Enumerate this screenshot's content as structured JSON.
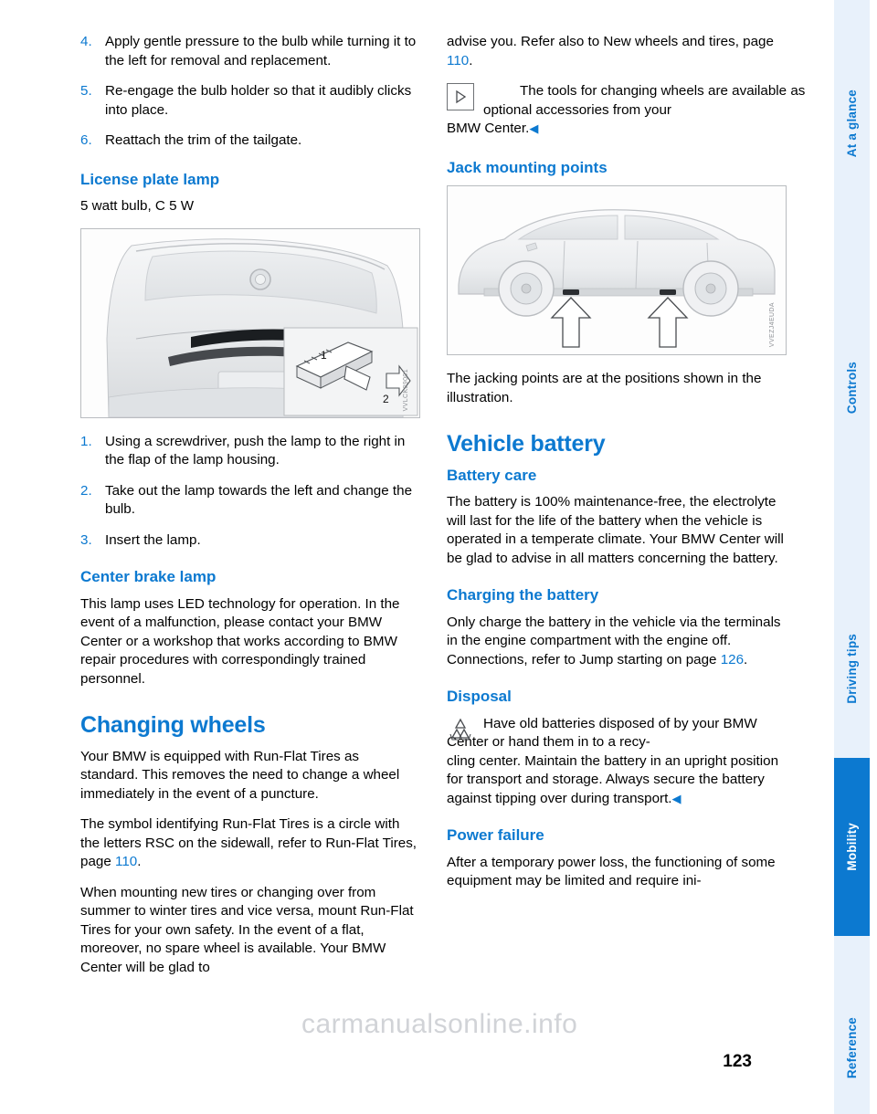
{
  "page": {
    "number": "123",
    "watermark": "carmanualsonline.info"
  },
  "rail": {
    "tabs": [
      {
        "label": "At a glance",
        "active": false
      },
      {
        "label": "Controls",
        "active": false
      },
      {
        "label": "Driving tips",
        "active": false
      },
      {
        "label": "Mobility",
        "active": true
      },
      {
        "label": "Reference",
        "active": false
      }
    ]
  },
  "left_column": {
    "steps_top": [
      {
        "num": "4.",
        "text": "Apply gentle pressure to the bulb while turning it to the left for removal and replacement."
      },
      {
        "num": "5.",
        "text": "Re-engage the bulb holder so that it audibly clicks into place."
      },
      {
        "num": "6.",
        "text": "Reattach the trim of the tailgate."
      }
    ],
    "license_lamp": {
      "heading": "License plate lamp",
      "spec": "5 watt bulb, C 5 W",
      "figure_code": "VVLCK09001",
      "figure_callouts": [
        "1",
        "2"
      ]
    },
    "steps_bottom": [
      {
        "num": "1.",
        "text": "Using a screwdriver, push the lamp to the right in the flap of the lamp housing."
      },
      {
        "num": "2.",
        "text": "Take out the lamp towards the left and change the bulb."
      },
      {
        "num": "3.",
        "text": "Insert the lamp."
      }
    ],
    "center_brake": {
      "heading": "Center brake lamp",
      "body": "This lamp uses LED technology for operation. In the event of a malfunction, please contact your BMW Center or a workshop that works according to BMW repair procedures with correspondingly trained personnel."
    },
    "changing_wheels": {
      "heading": "Changing wheels",
      "p1": "Your BMW is equipped with Run-Flat Tires as standard. This removes the need to change a wheel immediately in the event of a puncture.",
      "p2_a": "The symbol identifying Run-Flat Tires is a circle with the letters RSC on the sidewall, refer to Run-Flat Tires, page ",
      "p2_page": "110",
      "p2_b": ".",
      "p3": "When mounting new tires or changing over from summer to winter tires and vice versa, mount Run-Flat Tires for your own safety. In the event of a flat, moreover, no spare wheel is available. Your BMW Center will be glad to"
    }
  },
  "right_column": {
    "continuation_a": "advise you. Refer also to New wheels and tires, page ",
    "continuation_page": "110",
    "continuation_b": ".",
    "tools_note": {
      "icon": "triangle-right-icon",
      "text_first": "The tools for changing wheels are available as optional accessories from your",
      "text_rest": "BMW Center.",
      "end_mark": "◀"
    },
    "jack_points": {
      "heading": "Jack mounting points",
      "figure_code": "VVEZJ4EUDA",
      "caption": "The jacking points are at the positions shown in the illustration."
    },
    "vehicle_battery": {
      "heading": "Vehicle battery",
      "battery_care": {
        "heading": "Battery care",
        "body": "The battery is 100% maintenance-free, the electrolyte will last for the life of the battery when the vehicle is operated in a temperate climate. Your BMW Center will be glad to advise in all matters concerning the battery."
      },
      "charging": {
        "heading": "Charging the battery",
        "body_a": "Only charge the battery in the vehicle via the terminals in the engine compartment with the engine off. Connections, refer to Jump starting on page ",
        "body_page": "126",
        "body_b": "."
      },
      "disposal": {
        "heading": "Disposal",
        "icon": "recycle-icon",
        "text_first": "Have old batteries disposed of by your BMW Center or hand them in to a recy-",
        "text_rest": "cling center. Maintain the battery in an upright position for transport and storage. Always secure the battery against tipping over during transport.",
        "end_mark": "◀"
      },
      "power_failure": {
        "heading": "Power failure",
        "body": "After a temporary power loss, the functioning of some equipment may be limited and require ini-"
      }
    }
  },
  "colors": {
    "accent": "#0c79d0",
    "rail_bg": "#e8f1fb",
    "text": "#000000"
  }
}
